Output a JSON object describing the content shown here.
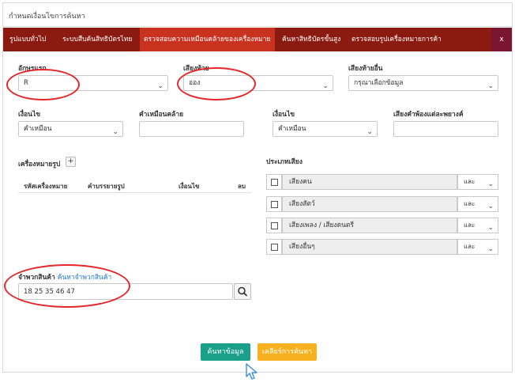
{
  "header": {
    "title": "กำหนดเงื่อนไขการค้นหา"
  },
  "tabs": [
    {
      "label": "รูปแบบทั่วไป",
      "active": false
    },
    {
      "label": "ระบบสืบค้นสิทธิบัตรไทย",
      "active": false
    },
    {
      "label": "ตรวจสอบความเหมือนคล้ายของเครื่องหมาย",
      "active": true
    },
    {
      "label": "ค้นหาสิทธิบัตรขั้นสูง",
      "active": false
    },
    {
      "label": "ตรวจสอบรูปเครื่องหมายการค้า",
      "active": false
    }
  ],
  "close_label": "x",
  "form": {
    "first_letter": {
      "label": "อักษรแรก",
      "value": "R"
    },
    "last_sound": {
      "label": "เสียงท้าย",
      "value": "ออง"
    },
    "other_last_sound": {
      "label": "เสียงท้ายอื่น",
      "value": "กรุณาเลือกข้อมูล"
    },
    "condition1": {
      "label": "เงื่อนไข",
      "value": "คำเหมือน"
    },
    "similar_word": {
      "label": "คำเหมือนคล้าย",
      "value": ""
    },
    "condition2": {
      "label": "เงื่อนไข",
      "value": "คำเหมือน"
    },
    "syllable_sound": {
      "label": "เสียงคำพ้องแต่ละพยางค์",
      "value": ""
    }
  },
  "mark_figures": {
    "label": "เครื่องหมายรูป",
    "add_label": "+",
    "columns": [
      "รหัสเครื่องหมาย",
      "คำบรรยายรูป",
      "เงื่อนไข",
      "ลบ"
    ]
  },
  "sound_types": {
    "label": "ประเภทเสียง",
    "rows": [
      {
        "label": "เสียงคน",
        "op": "และ"
      },
      {
        "label": "เสียงสัตว์",
        "op": "และ"
      },
      {
        "label": "เสียงเพลง / เสียงดนตรี",
        "op": "และ"
      },
      {
        "label": "เสียงอื่นๆ",
        "op": "และ"
      }
    ]
  },
  "goods_class": {
    "label": "จำพวกสินค้า",
    "link": "ค้นหาจำพวกสินค้า",
    "value": "18 25 35 46 47"
  },
  "buttons": {
    "search": "ค้นหาข้อมูล",
    "clear": "เคลียร์การค้นหา"
  },
  "colors": {
    "tabbar": "#8b1a10",
    "active_tab": "#c9321f",
    "search_button": "#1aa08a",
    "clear_button": "#f7b11e",
    "annotation": "#e5262a"
  }
}
